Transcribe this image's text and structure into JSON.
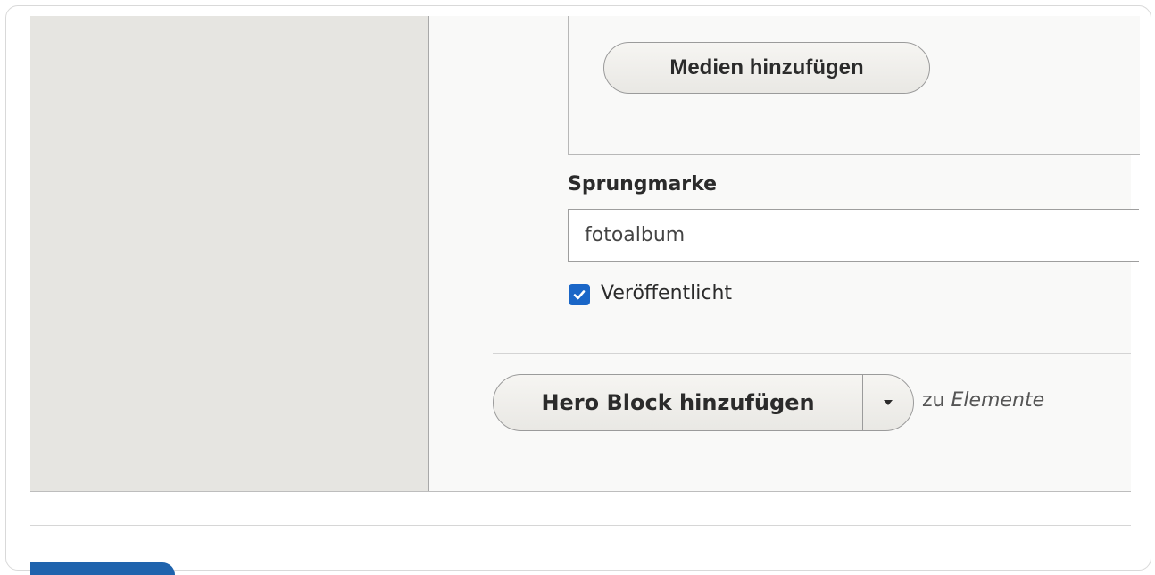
{
  "media": {
    "add_button_label": "Medien hinzufügen"
  },
  "anchor": {
    "label": "Sprungmarke",
    "value": "fotoalbum"
  },
  "published": {
    "label": "Veröffentlicht",
    "checked": true
  },
  "add_block": {
    "button_label": "Hero Block hinzufügen",
    "to_prefix": "zu",
    "target": "Elemente"
  },
  "colors": {
    "accent": "#1a66c7",
    "sidebar": "#e6e5e1"
  },
  "icons": {
    "checkbox": "checkmark-icon",
    "dropdown": "caret-down-icon"
  }
}
